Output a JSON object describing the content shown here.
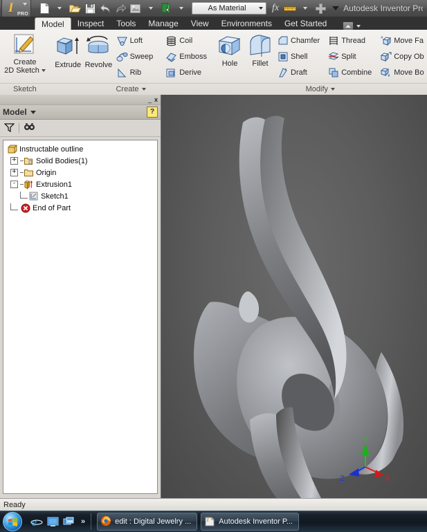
{
  "titlebar": {
    "app_logo": "inventor-logo",
    "pro_label": "PRO",
    "material_combo": "As Material",
    "fx_label": "fx",
    "window_title": "Autodesk Inventor Profe",
    "quick_access": [
      {
        "name": "new-file-icon",
        "label": "New"
      },
      {
        "name": "open-file-icon",
        "label": "Open"
      },
      {
        "name": "save-icon",
        "label": "Save"
      },
      {
        "name": "undo-icon",
        "label": "Undo"
      },
      {
        "name": "redo-icon",
        "label": "Redo"
      },
      {
        "name": "appearance-icon",
        "label": "Appearance"
      },
      {
        "name": "material-icon",
        "label": "Material"
      },
      {
        "name": "parameters-icon",
        "label": "Parameters"
      },
      {
        "name": "measure-icon",
        "label": "Measure"
      },
      {
        "name": "add-icon",
        "label": "Add"
      }
    ]
  },
  "ribbon": {
    "tabs": [
      {
        "label": "Model",
        "active": true
      },
      {
        "label": "Inspect",
        "active": false
      },
      {
        "label": "Tools",
        "active": false
      },
      {
        "label": "Manage",
        "active": false
      },
      {
        "label": "View",
        "active": false
      },
      {
        "label": "Environments",
        "active": false
      },
      {
        "label": "Get Started",
        "active": false
      }
    ],
    "minimize_label": "Minimize Ribbon",
    "panels": [
      {
        "title": "Sketch",
        "has_dropdown": false,
        "big": [
          {
            "label_line1": "Create",
            "label_line2": "2D Sketch",
            "icon": "create-2d-sketch-icon"
          }
        ],
        "small": []
      },
      {
        "title": "Create",
        "has_dropdown": true,
        "big": [
          {
            "label_line1": "Extrude",
            "label_line2": "",
            "icon": "extrude-icon"
          },
          {
            "label_line1": "Revolve",
            "label_line2": "",
            "icon": "revolve-icon"
          }
        ],
        "small": [
          {
            "label": "Loft",
            "icon": "loft-icon"
          },
          {
            "label": "Sweep",
            "icon": "sweep-icon"
          },
          {
            "label": "Rib",
            "icon": "rib-icon"
          },
          {
            "label": "Coil",
            "icon": "coil-icon"
          },
          {
            "label": "Emboss",
            "icon": "emboss-icon"
          },
          {
            "label": "Derive",
            "icon": "derive-icon"
          }
        ]
      },
      {
        "title": "Modify",
        "has_dropdown": true,
        "big": [
          {
            "label_line1": "Hole",
            "label_line2": "",
            "icon": "hole-icon"
          },
          {
            "label_line1": "Fillet",
            "label_line2": "",
            "icon": "fillet-icon"
          }
        ],
        "small": [
          {
            "label": "Chamfer",
            "icon": "chamfer-icon"
          },
          {
            "label": "Shell",
            "icon": "shell-icon"
          },
          {
            "label": "Draft",
            "icon": "draft-icon"
          },
          {
            "label": "Thread",
            "icon": "thread-icon"
          },
          {
            "label": "Split",
            "icon": "split-icon"
          },
          {
            "label": "Combine",
            "icon": "combine-icon"
          },
          {
            "label": "Move Fa",
            "icon": "move-face-icon"
          },
          {
            "label": "Copy Ob",
            "icon": "copy-object-icon"
          },
          {
            "label": "Move Bo",
            "icon": "move-bodies-icon"
          }
        ]
      }
    ]
  },
  "browser": {
    "title": "Model",
    "close_label": "x",
    "minimize_label": "_",
    "help_label": "?",
    "filter_tip": "Filter",
    "find_tip": "Find",
    "tree": [
      {
        "label": "Instructable outline",
        "depth": 0,
        "expander": "",
        "icon": "part-document-icon"
      },
      {
        "label": "Solid Bodies(1)",
        "depth": 1,
        "expander": "+",
        "icon": "solid-bodies-folder-icon"
      },
      {
        "label": "Origin",
        "depth": 1,
        "expander": "+",
        "icon": "origin-folder-icon"
      },
      {
        "label": "Extrusion1",
        "depth": 1,
        "expander": "-",
        "icon": "extrusion-feature-icon"
      },
      {
        "label": "Sketch1",
        "depth": 2,
        "expander": "",
        "icon": "sketch-icon"
      },
      {
        "label": "End of Part",
        "depth": 1,
        "expander": "",
        "icon": "end-of-part-icon"
      }
    ]
  },
  "viewport": {
    "model_name": "spiral-swirl-solid",
    "axis": {
      "x_label": "X",
      "y_label": "Y",
      "z_label": "Z",
      "x_color": "#d52020",
      "y_color": "#22c222",
      "z_color": "#2038e0"
    },
    "cursor": "mouse-pointer"
  },
  "statusbar": {
    "message": "Ready"
  },
  "taskbar": {
    "start_label": "Start",
    "overflow_label": "»",
    "quicklaunch": [
      {
        "name": "internet-explorer-icon",
        "label": "Internet Explorer"
      },
      {
        "name": "show-desktop-icon",
        "label": "Show Desktop"
      },
      {
        "name": "switch-window-icon",
        "label": "Switch Between Windows"
      }
    ],
    "windows": [
      {
        "label": "edit : Digital Jewelry ...",
        "icon": "firefox-icon"
      },
      {
        "label": "Autodesk Inventor P...",
        "icon": "inventor-icon"
      }
    ]
  }
}
